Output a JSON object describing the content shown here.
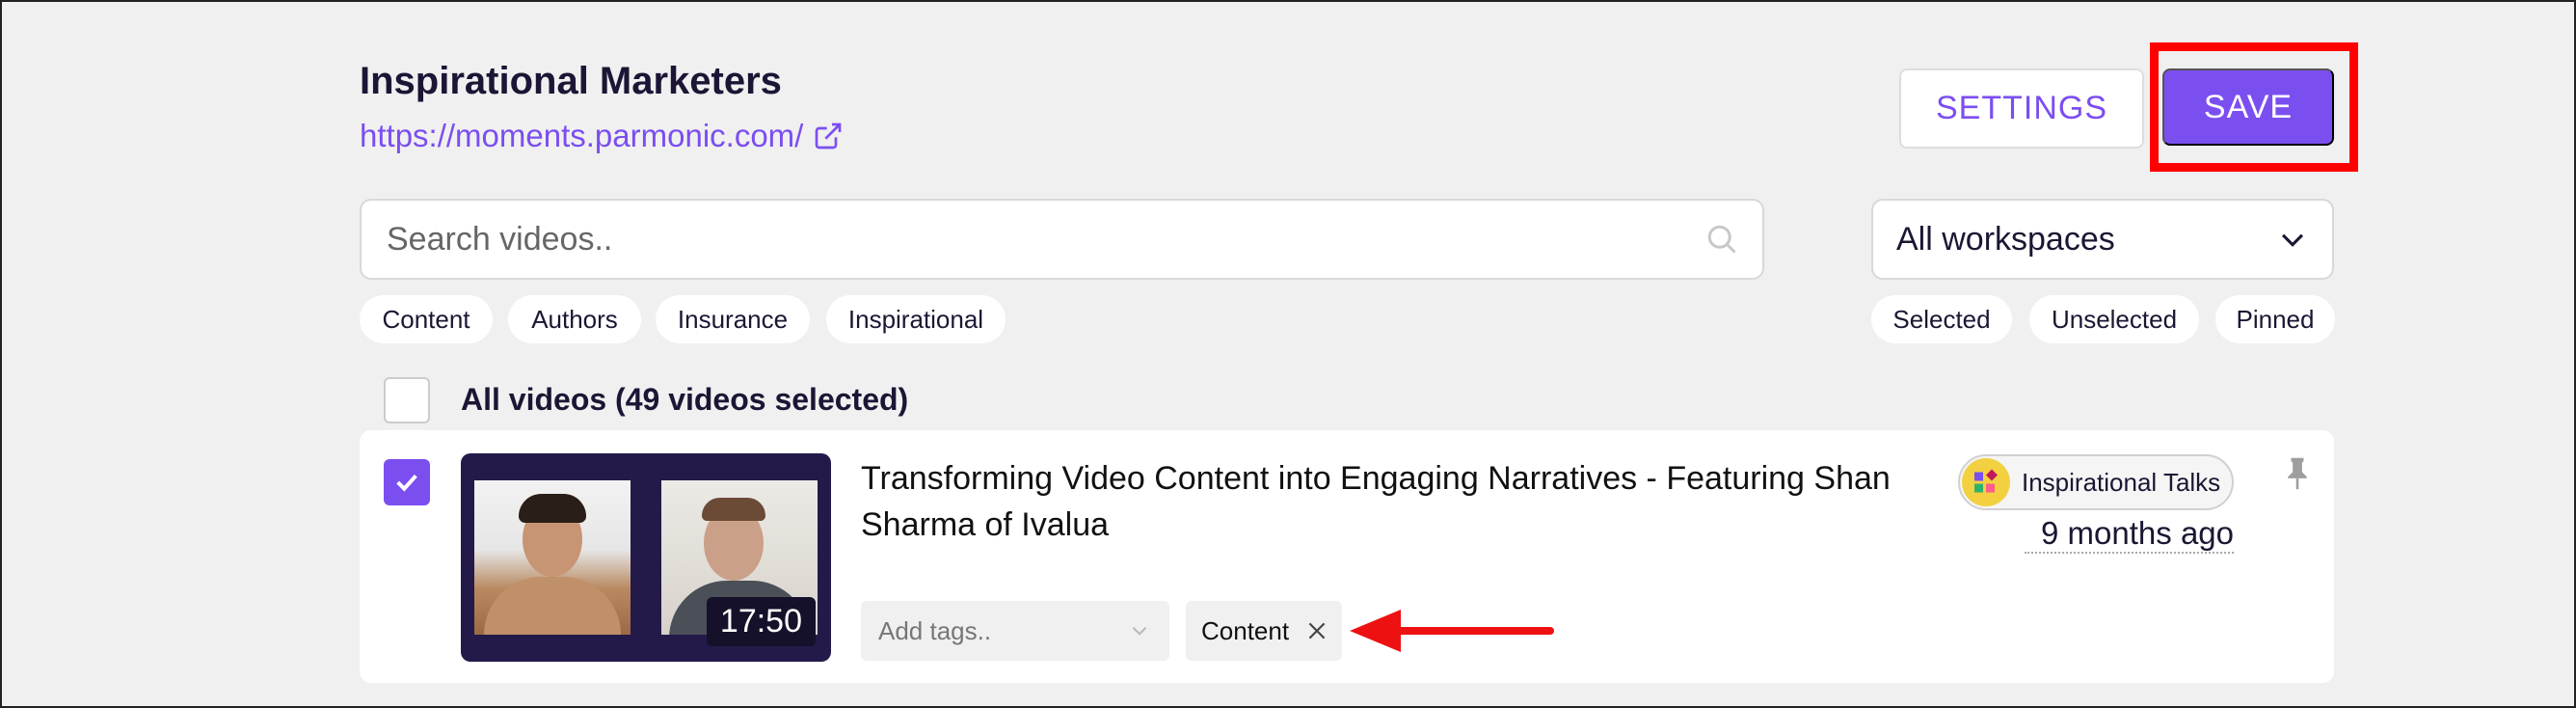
{
  "header": {
    "title": "Inspirational Marketers",
    "url": "https://moments.parmonic.com/",
    "settings_label": "SETTINGS",
    "save_label": "SAVE"
  },
  "search": {
    "placeholder": "Search videos.."
  },
  "workspace_select": {
    "value": "All workspaces"
  },
  "tag_filters": [
    "Content",
    "Authors",
    "Insurance",
    "Inspirational"
  ],
  "status_filters": [
    "Selected",
    "Unselected",
    "Pinned"
  ],
  "list_header": {
    "label": "All videos (49 videos selected)"
  },
  "videos": [
    {
      "title": "Transforming Video Content into Engaging Narratives - Featuring Shan Sharma of Ivalua",
      "duration": "17:50",
      "channel": "Inspirational Talks",
      "age": "9 months ago",
      "tags_placeholder": "Add tags..",
      "tags": [
        "Content"
      ],
      "selected": true
    }
  ],
  "colors": {
    "accent": "#7b4ef0",
    "highlight": "#ff0000",
    "background": "#f0f0f0"
  }
}
